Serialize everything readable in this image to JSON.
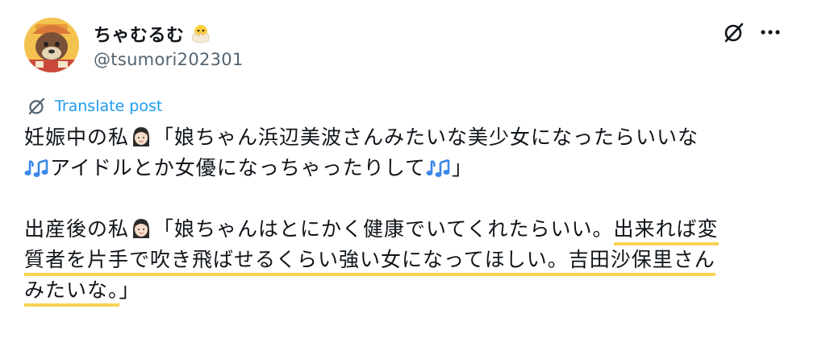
{
  "author": {
    "display_name": "ちゃむるむ",
    "handle": "@tsumori202301",
    "name_emoji": "hatching-chick-icon"
  },
  "actions": {
    "grok_icon": "grok-icon",
    "more_icon": "more-icon"
  },
  "translate": {
    "label": "Translate post"
  },
  "post": {
    "line1_a": "妊娠中の私",
    "line1_b": "「娘ちゃん浜辺美波さんみたいな美少女になったらいいな",
    "line2": "アイドルとか女優になっちゃったりして",
    "line2_end": "」",
    "line3_a": "出産後の私",
    "line3_b": "「娘ちゃんはとにかく健康でいてくれたらいい。",
    "line3_hl": "出来れば変",
    "line4_hl": "質者を片手で吹き飛ばせるくらい強い女になってほしい。吉田沙保里さん",
    "line5_hl": "みたいな。",
    "line5_end": "」"
  },
  "colors": {
    "link": "#1d9bf0",
    "secondary_text": "#536471",
    "highlight_underline": "#f7d354"
  }
}
